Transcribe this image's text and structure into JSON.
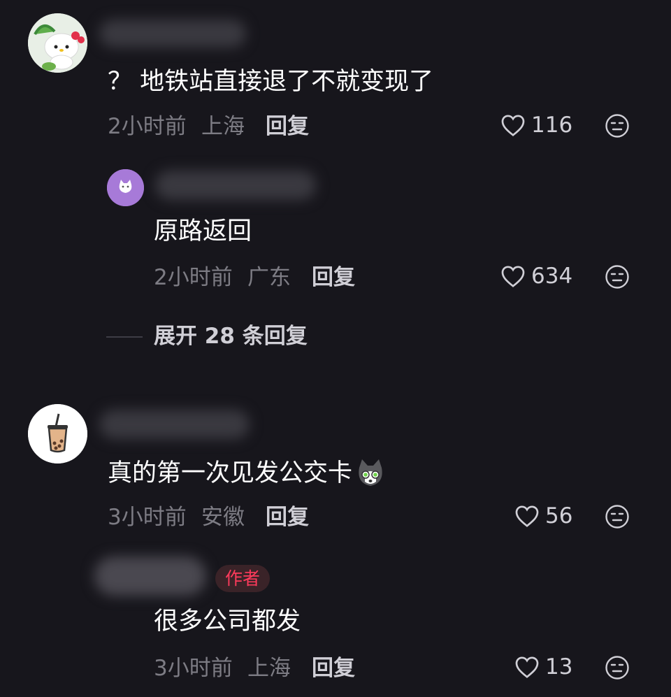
{
  "comments": [
    {
      "text": "？ 地铁站直接退了不就变现了",
      "time": "2小时前",
      "location": "上海",
      "reply": "回复",
      "likes": "116",
      "replies": [
        {
          "text": "原路返回",
          "time": "2小时前",
          "location": "广东",
          "reply": "回复",
          "likes": "634"
        }
      ],
      "expand": "展开 28 条回复"
    },
    {
      "text": "真的第一次见发公交卡",
      "time": "3小时前",
      "location": "安徽",
      "reply": "回复",
      "likes": "56",
      "replies": [
        {
          "badge": "作者",
          "text": "很多公司都发",
          "time": "3小时前",
          "location": "上海",
          "reply": "回复",
          "likes": "13"
        }
      ]
    }
  ],
  "colors": {
    "background": "#17161c",
    "author_badge": "#ff3b5c"
  }
}
